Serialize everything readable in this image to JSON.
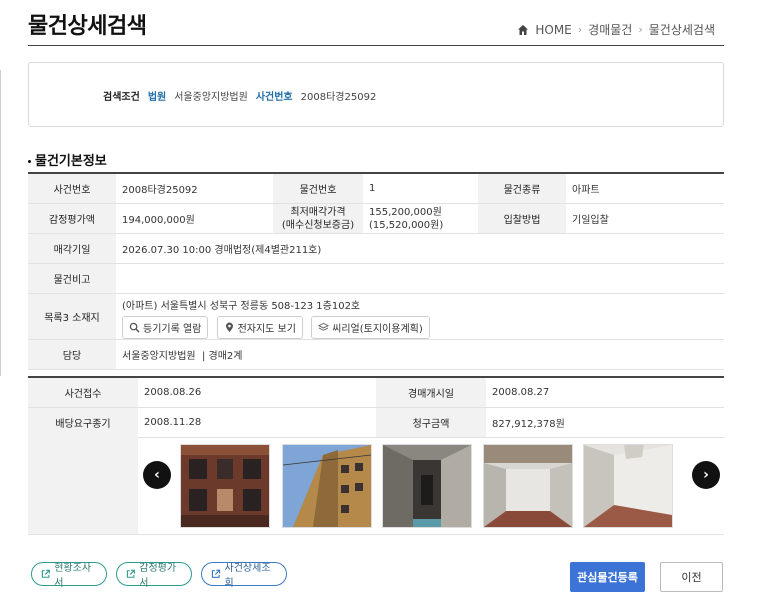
{
  "page": {
    "title": "물건상세검색"
  },
  "breadcrumb": {
    "home": "HOME",
    "level1": "경매물건",
    "level2": "물건상세검색"
  },
  "search": {
    "label": "검색조건",
    "court_label": "법원",
    "court_value": "서울중앙지방법원",
    "case_label": "사건번호",
    "case_value": "2008타경25092"
  },
  "section": {
    "title": "물건기본정보"
  },
  "basic": {
    "case_no_label": "사건번호",
    "case_no": "2008타경25092",
    "item_no_label": "물건번호",
    "item_no": "1",
    "item_type_label": "물건종류",
    "item_type": "아파트",
    "appraisal_label": "감정평가액",
    "appraisal": "194,000,000원",
    "min_price_label_1": "최저매각가격",
    "min_price_label_2": "(매수신청보증금)",
    "min_price": "155,200,000원",
    "deposit": "(15,520,000원)",
    "bid_method_label": "입찰방법",
    "bid_method": "기일입찰",
    "sale_date_label": "매각기일",
    "sale_date": "2026.07.30 10:00 경매법정(제4별관211호)",
    "remarks_label": "물건비고",
    "remarks": "",
    "address_label": "목록3 소재지",
    "address": "(아파트) 서울특별시 성북구 정릉동 508-123 1층102호",
    "btn_registry": "등기기록 열람",
    "btn_map": "전자지도 보기",
    "btn_seereal": "씨리얼(토지이용계획)",
    "charge_label": "담당",
    "charge": "서울중앙지방법원  | 경매2계"
  },
  "case": {
    "received_label": "사건접수",
    "received": "2008.08.26",
    "start_label": "경매개시일",
    "start": "2008.08.27",
    "deadline_label": "배당요구종기",
    "deadline": "2008.11.28",
    "claim_label": "청구금액",
    "claim": "827,912,378원"
  },
  "gallery": {
    "prev": "‹",
    "next": "›"
  },
  "actions": {
    "status_report": "현황조사서",
    "appraisal_report": "감정평가서",
    "case_detail": "사건상세조회",
    "register_interest": "관심물건등록",
    "back": "이전"
  },
  "colors": {
    "primary": "#3b74d6",
    "teal": "#2d9c8f",
    "link": "#1f6fa8"
  }
}
